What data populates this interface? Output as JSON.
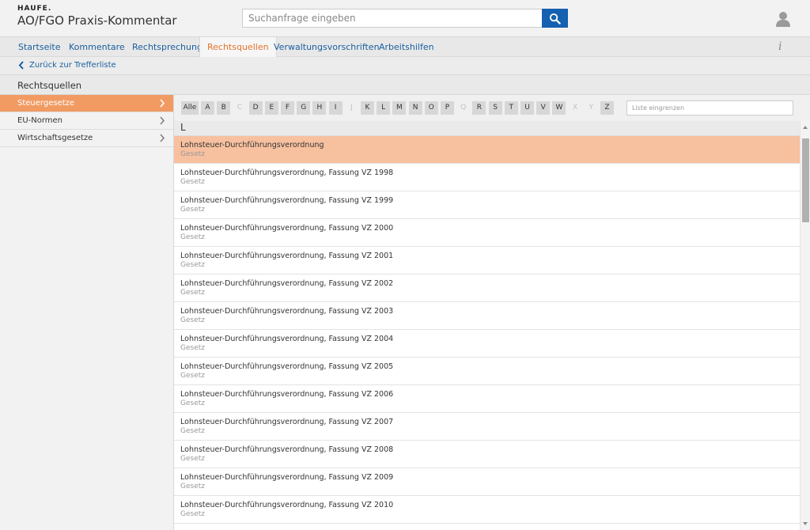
{
  "header": {
    "brand_small": "HAUFE.",
    "title": "AO/FGO Praxis-Kommentar",
    "search_placeholder": "Suchanfrage eingeben"
  },
  "nav": {
    "items": [
      "Startseite",
      "Kommentare",
      "Rechtsprechung",
      "Rechtsquellen",
      "Verwaltungsvorschriften",
      "Arbeitshilfen"
    ],
    "active": "Rechtsquellen",
    "info": "i"
  },
  "back": {
    "label": "Zurück zur Trefferliste"
  },
  "section": {
    "title": "Rechtsquellen"
  },
  "sidebar": {
    "items": [
      {
        "label": "Steuergesetze",
        "active": true
      },
      {
        "label": "EU-Normen",
        "active": false
      },
      {
        "label": "Wirtschaftsgesetze",
        "active": false
      }
    ]
  },
  "alphabet": {
    "all_label": "Alle",
    "letters": [
      {
        "l": "A",
        "enabled": true
      },
      {
        "l": "B",
        "enabled": true
      },
      {
        "l": "C",
        "enabled": false
      },
      {
        "l": "D",
        "enabled": true
      },
      {
        "l": "E",
        "enabled": true
      },
      {
        "l": "F",
        "enabled": true
      },
      {
        "l": "G",
        "enabled": true
      },
      {
        "l": "H",
        "enabled": true
      },
      {
        "l": "I",
        "enabled": true
      },
      {
        "l": "J",
        "enabled": false
      },
      {
        "l": "K",
        "enabled": true
      },
      {
        "l": "L",
        "enabled": true
      },
      {
        "l": "M",
        "enabled": true
      },
      {
        "l": "N",
        "enabled": true
      },
      {
        "l": "O",
        "enabled": true
      },
      {
        "l": "P",
        "enabled": true
      },
      {
        "l": "Q",
        "enabled": false
      },
      {
        "l": "R",
        "enabled": true
      },
      {
        "l": "S",
        "enabled": true
      },
      {
        "l": "T",
        "enabled": true
      },
      {
        "l": "U",
        "enabled": true
      },
      {
        "l": "V",
        "enabled": true
      },
      {
        "l": "W",
        "enabled": true
      },
      {
        "l": "X",
        "enabled": false
      },
      {
        "l": "Y",
        "enabled": false
      },
      {
        "l": "Z",
        "enabled": true
      }
    ],
    "filter_placeholder": "Liste eingrenzen"
  },
  "list": {
    "group_letter": "L",
    "items": [
      {
        "title": "Lohnsteuer-Durchführungsverordnung",
        "subtitle": "Gesetz",
        "selected": true
      },
      {
        "title": "Lohnsteuer-Durchführungsverordnung, Fassung VZ 1998",
        "subtitle": "Gesetz",
        "selected": false
      },
      {
        "title": "Lohnsteuer-Durchführungsverordnung, Fassung VZ 1999",
        "subtitle": "Gesetz",
        "selected": false
      },
      {
        "title": "Lohnsteuer-Durchführungsverordnung, Fassung VZ 2000",
        "subtitle": "Gesetz",
        "selected": false
      },
      {
        "title": "Lohnsteuer-Durchführungsverordnung, Fassung VZ 2001",
        "subtitle": "Gesetz",
        "selected": false
      },
      {
        "title": "Lohnsteuer-Durchführungsverordnung, Fassung VZ 2002",
        "subtitle": "Gesetz",
        "selected": false
      },
      {
        "title": "Lohnsteuer-Durchführungsverordnung, Fassung VZ 2003",
        "subtitle": "Gesetz",
        "selected": false
      },
      {
        "title": "Lohnsteuer-Durchführungsverordnung, Fassung VZ 2004",
        "subtitle": "Gesetz",
        "selected": false
      },
      {
        "title": "Lohnsteuer-Durchführungsverordnung, Fassung VZ 2005",
        "subtitle": "Gesetz",
        "selected": false
      },
      {
        "title": "Lohnsteuer-Durchführungsverordnung, Fassung VZ 2006",
        "subtitle": "Gesetz",
        "selected": false
      },
      {
        "title": "Lohnsteuer-Durchführungsverordnung, Fassung VZ 2007",
        "subtitle": "Gesetz",
        "selected": false
      },
      {
        "title": "Lohnsteuer-Durchführungsverordnung, Fassung VZ 2008",
        "subtitle": "Gesetz",
        "selected": false
      },
      {
        "title": "Lohnsteuer-Durchführungsverordnung, Fassung VZ 2009",
        "subtitle": "Gesetz",
        "selected": false
      },
      {
        "title": "Lohnsteuer-Durchführungsverordnung, Fassung VZ 2010",
        "subtitle": "Gesetz",
        "selected": false
      }
    ]
  },
  "colors": {
    "accent": "#e3742c",
    "link": "#1b5fa0",
    "selected_row": "#f7c09f",
    "active_sidebar": "#f19b63",
    "search_button": "#1560b0"
  },
  "icons": {
    "search": "search-icon",
    "user": "user-icon",
    "info": "info-icon",
    "back": "chevron-left-icon",
    "sidebar_chevron": "chevron-right-icon"
  }
}
